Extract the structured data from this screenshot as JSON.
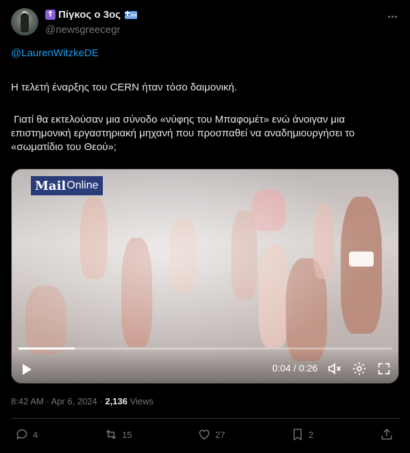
{
  "author": {
    "display_name": "Πίγκος ο 3ος",
    "handle": "@newsgreecegr",
    "badge_icon": "orthodox-cross-icon",
    "flag_icon": "greece-flag-icon"
  },
  "tweet": {
    "mention": "@LaurenWitzkeDE",
    "line1": "Η τελετή έναρξης του CERN ήταν τόσο δαιμονική.",
    "line2": " Γιατί θα εκτελούσαν μια σύνοδο «νύφης του Μπαφομέτ» ενώ άνοιγαν μια επιστημονική εργαστηριακή μηχανή που προσπαθεί να αναδημιουργήσει το «σωματίδιο του Θεού»;"
  },
  "video": {
    "logo_main": "Mail",
    "logo_sub": "Online",
    "time": "0:04 / 0:26",
    "progress": 0.15
  },
  "meta": {
    "time": "8:42 AM",
    "sep": " · ",
    "date": "Apr 6, 2024",
    "sep2": " · ",
    "views_count": "2,136",
    "views_label": " Views"
  },
  "actions": {
    "replies": "4",
    "reposts": "15",
    "likes": "27",
    "bookmarks": "2"
  },
  "colors": {
    "accent": "#1d9bf0",
    "muted": "#71767b",
    "text": "#e7e9ea",
    "bg": "#000000"
  }
}
